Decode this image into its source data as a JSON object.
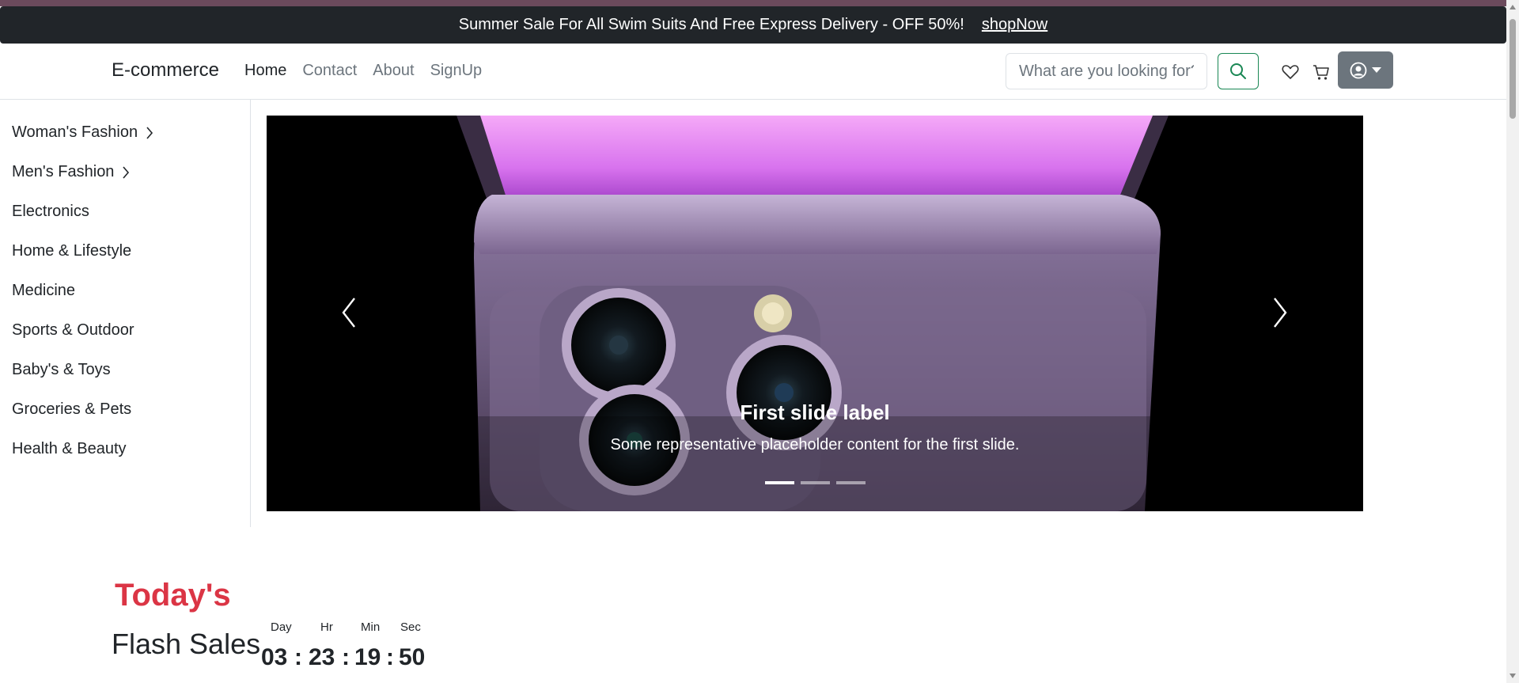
{
  "promo": {
    "text": "Summer Sale For All Swim Suits And Free Express Delivery - OFF 50%!",
    "link": "shopNow"
  },
  "navbar": {
    "brand": "E-commerce",
    "links": [
      "Home",
      "Contact",
      "About",
      "SignUp"
    ],
    "active_link": "Home",
    "search_placeholder": "What are you looking for?",
    "icons": [
      "search-icon",
      "heart-icon",
      "cart-icon",
      "user-circle-icon",
      "caret-down-icon"
    ]
  },
  "sidebar": {
    "items": [
      {
        "label": "Woman's Fashion",
        "has_submenu": true
      },
      {
        "label": "Men's Fashion",
        "has_submenu": true
      },
      {
        "label": "Electronics",
        "has_submenu": false
      },
      {
        "label": "Home & Lifestyle",
        "has_submenu": false
      },
      {
        "label": "Medicine",
        "has_submenu": false
      },
      {
        "label": "Sports & Outdoor",
        "has_submenu": false
      },
      {
        "label": "Baby's & Toys",
        "has_submenu": false
      },
      {
        "label": "Groceries & Pets",
        "has_submenu": false
      },
      {
        "label": "Health & Beauty",
        "has_submenu": false
      }
    ]
  },
  "carousel": {
    "caption_title": "First slide label",
    "caption_text": "Some representative placeholder content for the first slide.",
    "slide_count": 3,
    "active_slide": 1
  },
  "flash_sales": {
    "tag": "Today's",
    "title": "Flash Sales",
    "timer": {
      "labels": [
        "Day",
        "Hr",
        "Min",
        "Sec"
      ],
      "values": [
        "03",
        "23",
        "19",
        "50"
      ],
      "separator": ":"
    }
  },
  "colors": {
    "accent_red": "#db3545",
    "promo_bg": "#212529",
    "search_border": "#198754",
    "user_button": "#6c757d"
  }
}
